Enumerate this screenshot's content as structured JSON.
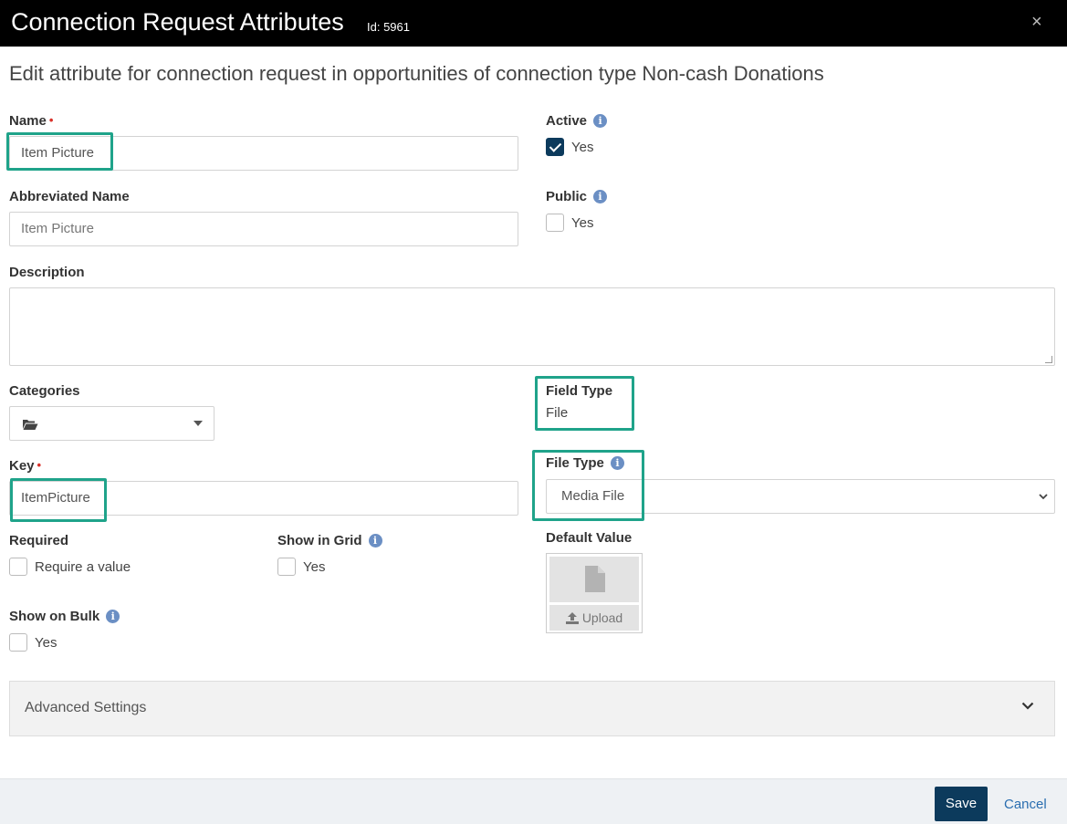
{
  "header": {
    "title": "Connection Request Attributes",
    "id_label": "Id: 5961",
    "close_glyph": "×"
  },
  "subtitle": "Edit attribute for connection request in opportunities of connection type Non-cash Donations",
  "required_mark": "•",
  "info_glyph": "i",
  "form": {
    "name": {
      "label": "Name",
      "value": "Item Picture",
      "required": true
    },
    "abbreviated_name": {
      "label": "Abbreviated Name",
      "placeholder": "Item Picture"
    },
    "active": {
      "label": "Active",
      "option": "Yes",
      "checked": true
    },
    "public": {
      "label": "Public",
      "option": "Yes",
      "checked": false
    },
    "description": {
      "label": "Description",
      "value": ""
    },
    "categories": {
      "label": "Categories",
      "icon": "folder-open-icon"
    },
    "field_type": {
      "label": "Field Type",
      "value": "File"
    },
    "key": {
      "label": "Key",
      "value": "ItemPicture",
      "required": true
    },
    "file_type": {
      "label": "File Type",
      "selected": "Media File"
    },
    "required": {
      "label": "Required",
      "option": "Require a value",
      "checked": false
    },
    "show_in_grid": {
      "label": "Show in Grid",
      "option": "Yes",
      "checked": false
    },
    "default_value": {
      "label": "Default Value",
      "upload_label": "Upload",
      "icon": "file-icon"
    },
    "show_on_bulk": {
      "label": "Show on Bulk",
      "option": "Yes",
      "checked": false
    }
  },
  "advanced": {
    "label": "Advanced Settings"
  },
  "footer": {
    "save_label": "Save",
    "cancel_label": "Cancel"
  },
  "colors": {
    "header_bg": "#000000",
    "primary": "#0c3a5c",
    "highlight": "#1fa38a",
    "link": "#2a6eb0",
    "required": "#d9312a",
    "info": "#6b8fc4"
  }
}
